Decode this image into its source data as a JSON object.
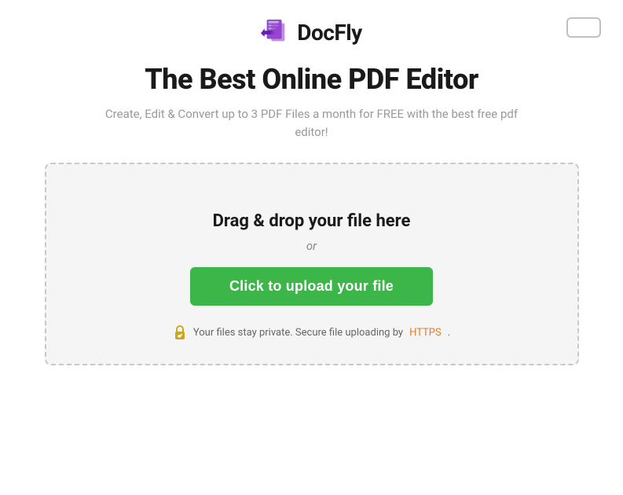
{
  "header": {
    "logo_text": "DocFly",
    "top_btn_label": ""
  },
  "main": {
    "title": "The Best Online PDF Editor",
    "subtitle": "Create, Edit & Convert up to 3 PDF Files a month for FREE with the best free pdf editor!",
    "dropzone": {
      "drag_drop_text": "Drag & drop your file here",
      "or_text": "or",
      "upload_btn_label": "Click to upload your file",
      "security_text_before": "Your files stay private. Secure file uploading by ",
      "security_https": "HTTPS",
      "security_text_after": "."
    }
  }
}
